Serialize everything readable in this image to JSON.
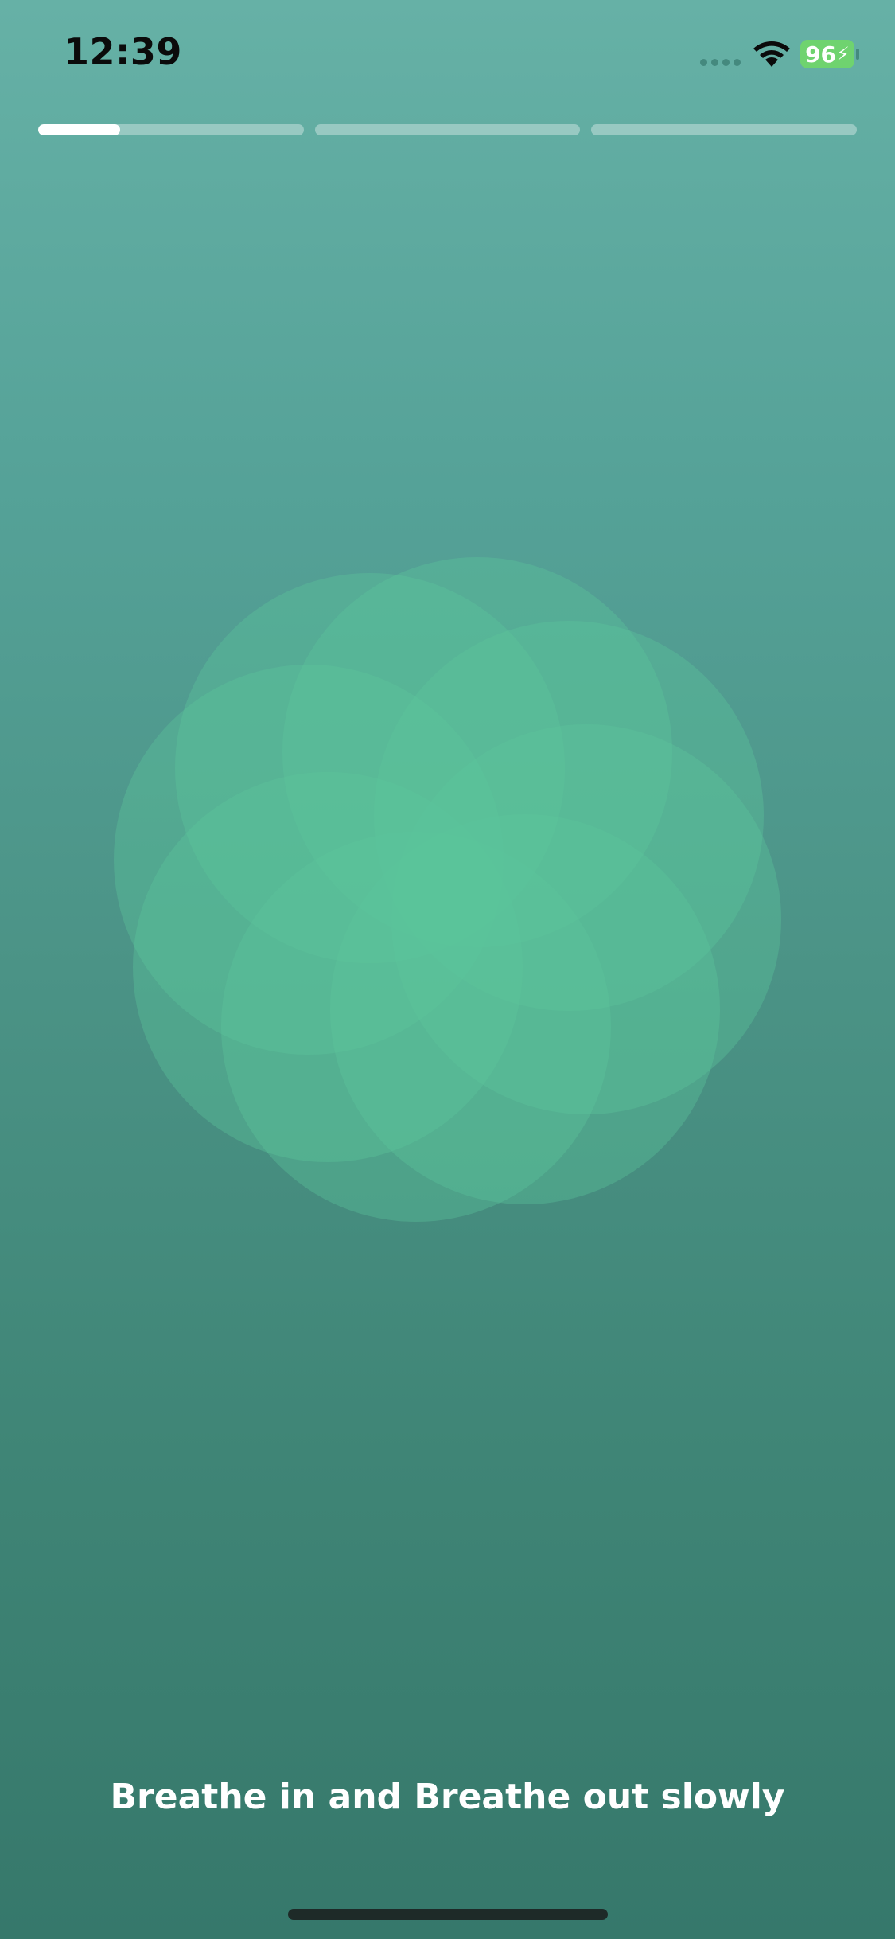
{
  "status_bar": {
    "time": "12:39",
    "battery_level": "96",
    "wifi_icon": "wifi-icon",
    "battery_icon": "battery-charging-icon"
  },
  "progress": {
    "segments": [
      {
        "fill": 0.31
      },
      {
        "fill": 0
      },
      {
        "fill": 0
      }
    ]
  },
  "breathing": {
    "caption": "Breathe in and Breathe out slowly"
  },
  "colors": {
    "background_top": "#66b1a6",
    "background_bottom": "#36786b",
    "petal": "#5cc59a"
  }
}
